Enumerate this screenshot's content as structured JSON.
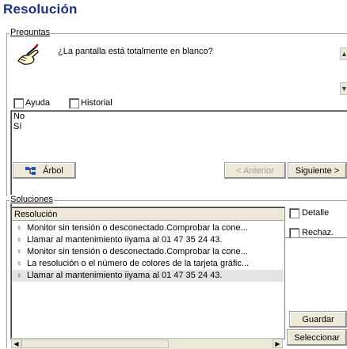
{
  "window": {
    "title": "Resolución"
  },
  "questions": {
    "group_label": "Preguntas",
    "question_text": "¿La pantalla está totalmente en blanco?",
    "help_checkbox": "Ayuda",
    "history_checkbox": "Historial",
    "answers": [
      "No",
      "Sí"
    ],
    "tree_button": "Árbol",
    "previous_button": "< Anterior",
    "next_button": "Siguiente >"
  },
  "solutions": {
    "group_label": "Soluciones",
    "column_header": "Resolución",
    "rows": [
      {
        "text": "Monitor sin tensión o desconectado.Comprobar la cone...",
        "selected": false
      },
      {
        "text": "Llamar al mantenimiento iiyama al 01 47 35 24 43.",
        "selected": false
      },
      {
        "text": "Monitor sin tensión o desconectado.Comprobar la cone...",
        "selected": false
      },
      {
        "text": "La resolución o el número de colores de la tarjeta gráfic...",
        "selected": false
      },
      {
        "text": "Llamar al mantenimiento iiyama al 01 47 35 24 43.",
        "selected": true
      }
    ],
    "detail_checkbox": "Detalle",
    "reject_checkbox": "Rechaz.",
    "save_button": "Guardar",
    "select_button": "Seleccionar"
  },
  "icons": {
    "wizard": "magic-wand-hand-icon",
    "tree": "tree-icon",
    "bulb": "lightbulb-icon"
  },
  "colors": {
    "title": "#1a2f8c",
    "selected_row": "#e4e4e4"
  }
}
